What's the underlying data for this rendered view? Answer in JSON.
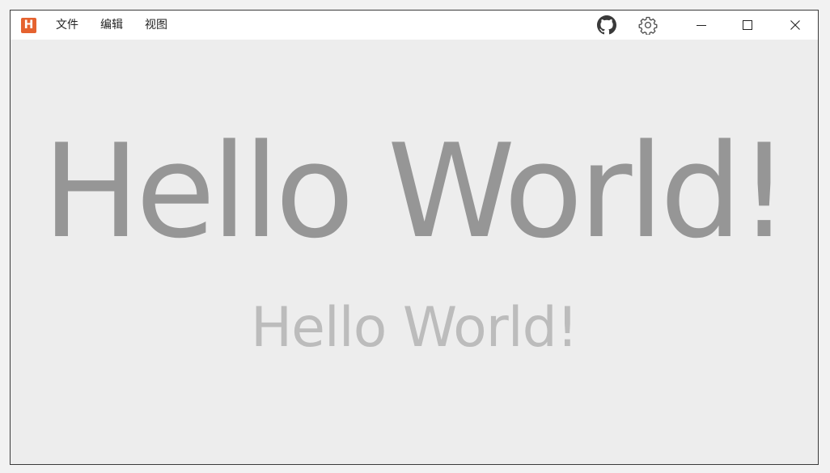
{
  "app": {
    "logo_letter": "H",
    "logo_color": "#e5622f"
  },
  "menu": {
    "file": "文件",
    "edit": "编辑",
    "view": "视图"
  },
  "toolbar_icons": [
    "github-icon",
    "gear-icon"
  ],
  "window_controls": [
    "minimize-icon",
    "maximize-icon",
    "close-icon"
  ],
  "content": {
    "headline": "Hello World!",
    "subheadline": "Hello World!",
    "headline_color": "#969696",
    "subheadline_color": "#bcbcbc"
  }
}
